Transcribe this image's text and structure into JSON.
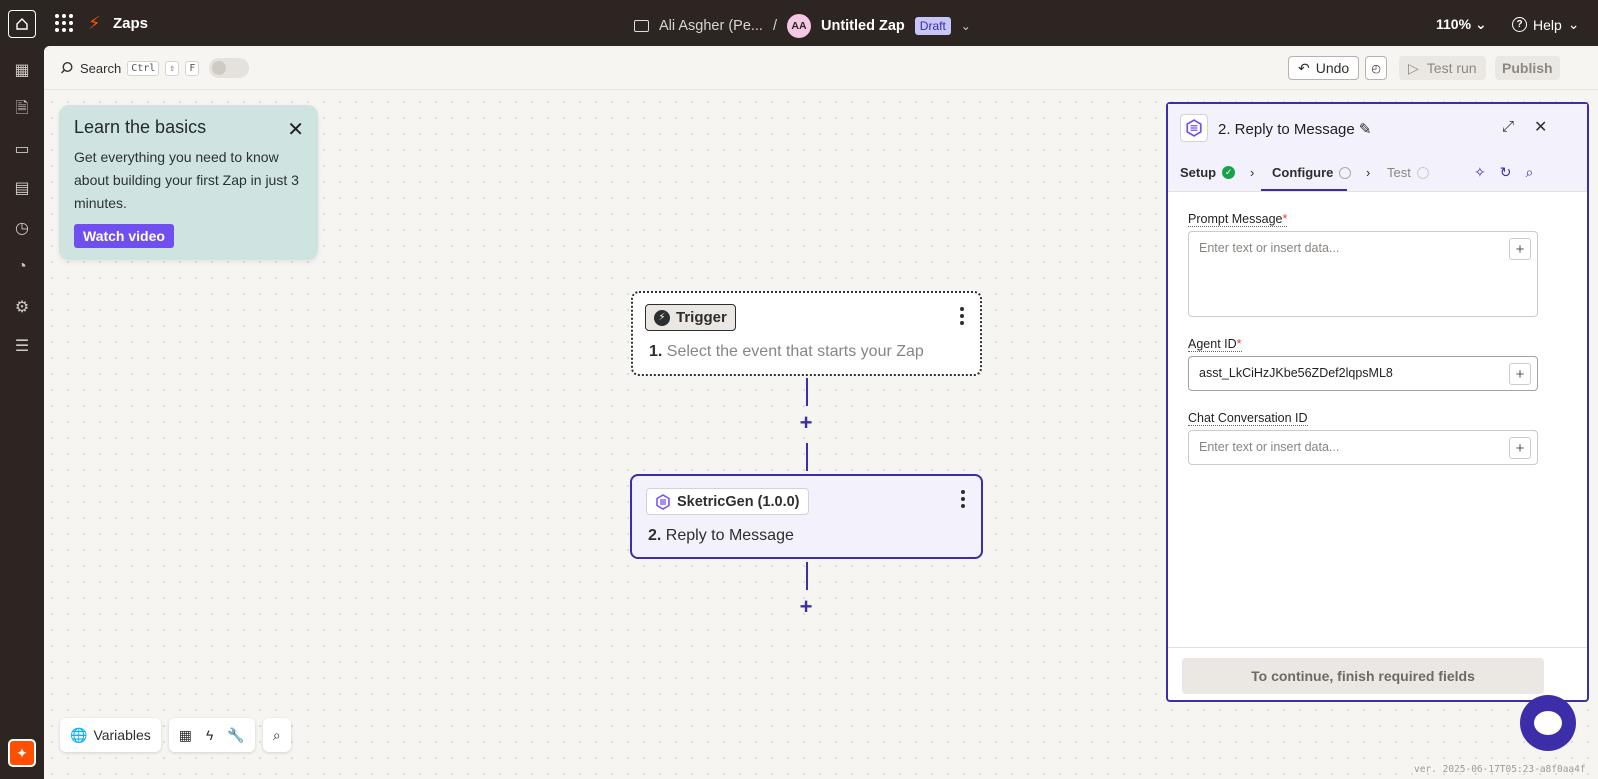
{
  "topbar": {
    "app_name": "Zaps",
    "breadcrumb_owner": "Ali Asgher (Pe...",
    "separator": "/",
    "avatar_initials": "AA",
    "zap_title": "Untitled Zap",
    "status_badge": "Draft",
    "zoom": "110%",
    "help_label": "Help"
  },
  "toolbar": {
    "search_label": "Search",
    "shortcut_keys": [
      "Ctrl",
      "⇧",
      "F"
    ],
    "undo_label": "Undo",
    "test_run_label": "Test run",
    "publish_label": "Publish"
  },
  "learn_card": {
    "title": "Learn the basics",
    "body": "Get everything you need to know about building your first Zap in just 3 minutes.",
    "button": "Watch video"
  },
  "trigger_node": {
    "tag": "Trigger",
    "step_number": "1.",
    "description": "Select the event that starts your Zap"
  },
  "action_node": {
    "tag": "SketricGen (1.0.0)",
    "step_number": "2.",
    "description": "Reply to Message"
  },
  "panel": {
    "title": "2. Reply to Message",
    "tabs": [
      {
        "label": "Setup",
        "status": "complete"
      },
      {
        "label": "Configure",
        "status": "active"
      },
      {
        "label": "Test",
        "status": "pending"
      }
    ],
    "fields": [
      {
        "label": "Prompt Message",
        "required": true,
        "value": "",
        "placeholder": "Enter text or insert data..."
      },
      {
        "label": "Agent ID",
        "required": true,
        "value": "asst_LkCiHzJKbe56ZDef2lqpsML8",
        "placeholder": ""
      },
      {
        "label": "Chat Conversation ID",
        "required": false,
        "value": "",
        "placeholder": "Enter text or insert data..."
      }
    ],
    "continue_label": "To continue, finish required fields"
  },
  "bottombar": {
    "variables_label": "Variables"
  },
  "version": "ver. 2025-06-17T05:23-a8f0aa4f",
  "colors": {
    "accent": "#3b2ea8",
    "brand_orange": "#ff4f00",
    "success": "#16a34a",
    "required": "#e5413b"
  }
}
